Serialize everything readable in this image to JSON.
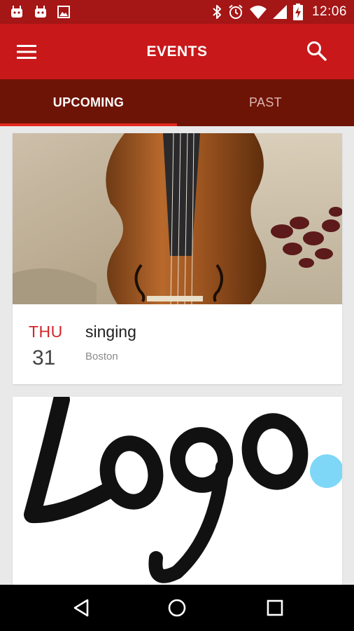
{
  "status_bar": {
    "time": "12:06",
    "left_icons": [
      "android-icon",
      "android-icon",
      "image-icon"
    ],
    "right_icons": [
      "bluetooth-icon",
      "alarm-icon",
      "wifi-icon",
      "signal-icon",
      "battery-charging-icon"
    ]
  },
  "app_bar": {
    "title": "EVENTS",
    "menu_icon": "menu-icon",
    "search_icon": "search-icon"
  },
  "tabs": [
    {
      "label": "UPCOMING",
      "active": true
    },
    {
      "label": "PAST",
      "active": false
    }
  ],
  "events": [
    {
      "image": "cello-photo",
      "day": "THU",
      "date": "31",
      "name": "singing",
      "location": "Boston"
    },
    {
      "image": "logo-image",
      "logo_text": "Logo"
    }
  ],
  "nav_bar": {
    "icons": [
      "back-icon",
      "home-icon",
      "recents-icon"
    ]
  },
  "colors": {
    "status_bar": "#a51616",
    "app_bar": "#c8181a",
    "tab_bar": "#6e1407",
    "tab_indicator": "#e5291f",
    "accent_day": "#d4262a",
    "background": "#e9e9e9"
  }
}
